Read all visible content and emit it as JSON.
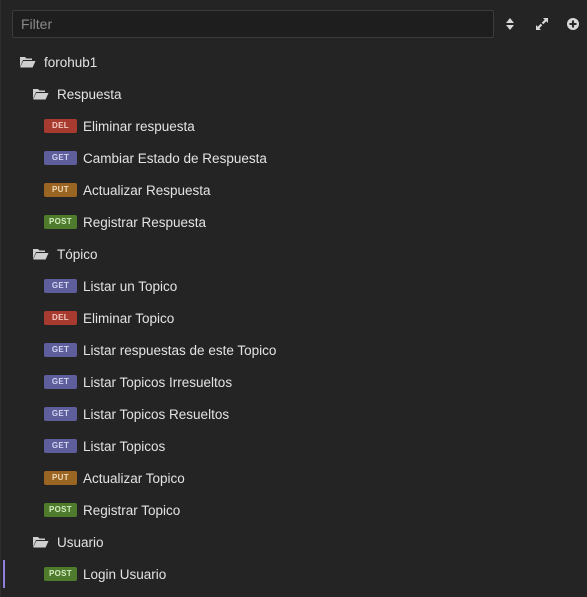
{
  "filter": {
    "placeholder": "Filter",
    "value": ""
  },
  "toolbar": {
    "sort_icon": "sort-updown-icon",
    "expand_icon": "expand-arrows-icon",
    "add_icon": "add-circle-icon"
  },
  "colors": {
    "background": "#242424",
    "del": "#a83b2f",
    "get": "#5e5e9c",
    "put": "#9a6422",
    "post": "#4e7c2c",
    "selection": "#8f7fd8"
  },
  "tree": {
    "collection": {
      "label": "forohub1",
      "icon": "folder-open-icon"
    },
    "folders": [
      {
        "label": "Respuesta",
        "icon": "folder-open-icon",
        "requests": [
          {
            "method": "DEL",
            "label": "Eliminar respuesta"
          },
          {
            "method": "GET",
            "label": "Cambiar Estado de Respuesta"
          },
          {
            "method": "PUT",
            "label": "Actualizar Respuesta"
          },
          {
            "method": "POST",
            "label": "Registrar Respuesta"
          }
        ]
      },
      {
        "label": "Tópico",
        "icon": "folder-open-icon",
        "requests": [
          {
            "method": "GET",
            "label": "Listar un Topico"
          },
          {
            "method": "DEL",
            "label": "Eliminar Topico"
          },
          {
            "method": "GET",
            "label": "Listar respuestas de este Topico"
          },
          {
            "method": "GET",
            "label": "Listar Topicos Irresueltos"
          },
          {
            "method": "GET",
            "label": "Listar Topicos Resueltos"
          },
          {
            "method": "GET",
            "label": "Listar Topicos"
          },
          {
            "method": "PUT",
            "label": "Actualizar Topico"
          },
          {
            "method": "POST",
            "label": "Registrar Topico"
          }
        ]
      },
      {
        "label": "Usuario",
        "icon": "folder-open-icon",
        "requests": [
          {
            "method": "POST",
            "label": "Login Usuario",
            "selected": true
          }
        ]
      }
    ]
  }
}
